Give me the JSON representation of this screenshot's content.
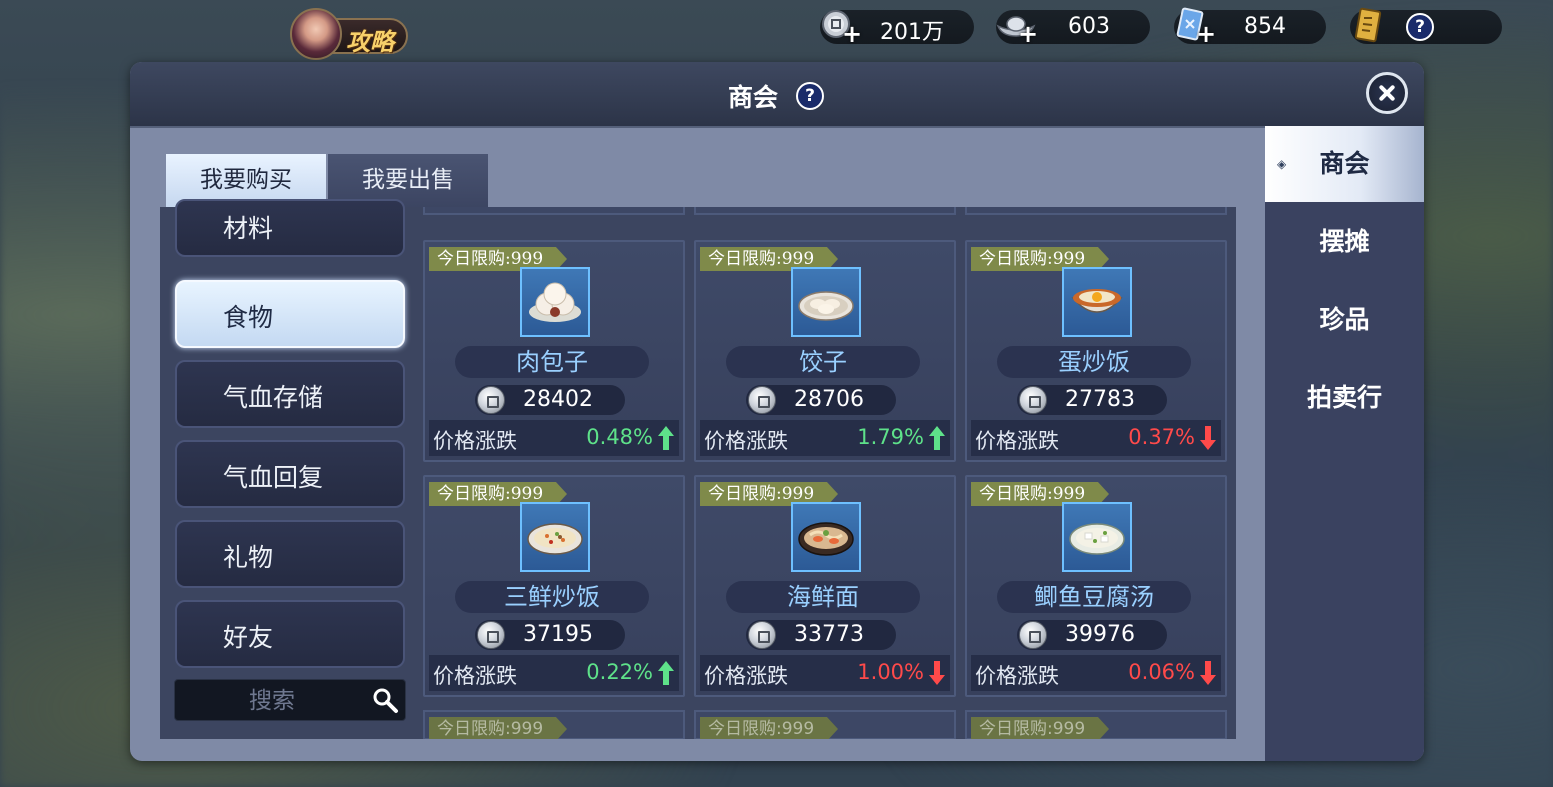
{
  "top_bar": {
    "strategy_label": "攻略",
    "currencies": [
      {
        "icon": "silver-coin-icon",
        "amount": "201万"
      },
      {
        "icon": "silver-ingot-icon",
        "amount": "603"
      },
      {
        "icon": "blue-ticket-icon",
        "amount": "854"
      },
      {
        "icon": "gold-scroll-icon",
        "amount": "?"
      }
    ]
  },
  "panel": {
    "title": "商会",
    "help": "?"
  },
  "tabs": {
    "buy": "我要购买",
    "sell": "我要出售"
  },
  "categories": [
    {
      "label": "材料"
    },
    {
      "label": "食物"
    },
    {
      "label": "气血存储"
    },
    {
      "label": "气血回复"
    },
    {
      "label": "礼物"
    },
    {
      "label": "好友"
    }
  ],
  "search": {
    "placeholder": "搜索"
  },
  "right_nav": [
    {
      "label": "商会"
    },
    {
      "label": "摆摊"
    },
    {
      "label": "珍品"
    },
    {
      "label": "拍卖行"
    }
  ],
  "items": [
    {
      "limit": "今日限购:999",
      "name": "肉包子",
      "price": "28402",
      "change_label": "价格涨跌",
      "change": "0.48%",
      "trend": "up"
    },
    {
      "limit": "今日限购:999",
      "name": "饺子",
      "price": "28706",
      "change_label": "价格涨跌",
      "change": "1.79%",
      "trend": "up"
    },
    {
      "limit": "今日限购:999",
      "name": "蛋炒饭",
      "price": "27783",
      "change_label": "价格涨跌",
      "change": "0.37%",
      "trend": "down"
    },
    {
      "limit": "今日限购:999",
      "name": "三鲜炒饭",
      "price": "37195",
      "change_label": "价格涨跌",
      "change": "0.22%",
      "trend": "up"
    },
    {
      "limit": "今日限购:999",
      "name": "海鲜面",
      "price": "33773",
      "change_label": "价格涨跌",
      "change": "1.00%",
      "trend": "down"
    },
    {
      "limit": "今日限购:999",
      "name": "鲫鱼豆腐汤",
      "price": "39976",
      "change_label": "价格涨跌",
      "change": "0.06%",
      "trend": "down"
    }
  ],
  "partial_limit": "今日限购:999",
  "colors": {
    "up": "#5ee28a",
    "down": "#ff4a4a",
    "name": "#9ad0ff",
    "limit_tag": "#7f8a4a"
  }
}
